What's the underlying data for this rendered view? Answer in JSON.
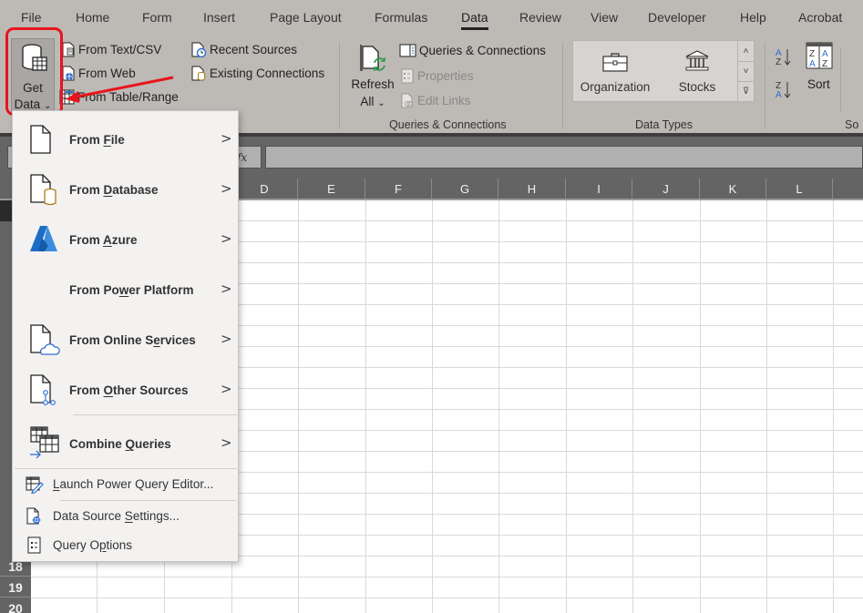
{
  "tabs": [
    {
      "label": "File"
    },
    {
      "label": "Home"
    },
    {
      "label": "Form"
    },
    {
      "label": "Insert"
    },
    {
      "label": "Page Layout"
    },
    {
      "label": "Formulas"
    },
    {
      "label": "Data",
      "active": true
    },
    {
      "label": "Review"
    },
    {
      "label": "View"
    },
    {
      "label": "Developer"
    },
    {
      "label": "Help"
    },
    {
      "label": "Acrobat"
    }
  ],
  "ribbon": {
    "get_data": {
      "line1": "Get",
      "line2": "Data",
      "caret": "⌄"
    },
    "get_transform": {
      "from_text_csv": "From Text/CSV",
      "from_web": "From Web",
      "from_table_range": "From Table/Range",
      "recent_sources": "Recent Sources",
      "existing_connections": "Existing Connections"
    },
    "queries": {
      "refresh_line1": "Refresh",
      "refresh_line2": "All",
      "refresh_caret": "⌄",
      "queries_connections": "Queries & Connections",
      "properties": "Properties",
      "edit_links": "Edit Links",
      "group_label": "Queries & Connections"
    },
    "data_types": {
      "organization": "Organization",
      "stocks": "Stocks",
      "group_label": "Data Types",
      "scroll_up": "˄",
      "scroll_down": "˅",
      "more": "⊽"
    },
    "sort_filter": {
      "sort": "Sort",
      "group_label_partial": "So"
    }
  },
  "formula_bar": {
    "fx": "fx",
    "value": ""
  },
  "columns": [
    "D",
    "E",
    "F",
    "G",
    "H",
    "I",
    "J",
    "K",
    "L"
  ],
  "rows": [
    "18",
    "19",
    "20"
  ],
  "menu": {
    "items": [
      {
        "pre": "From ",
        "ul": "F",
        "post": "ile",
        "chevron": ">"
      },
      {
        "pre": "From ",
        "ul": "D",
        "post": "atabase",
        "chevron": ">"
      },
      {
        "pre": "From ",
        "ul": "A",
        "post": "zure",
        "chevron": ">"
      },
      {
        "pre": "From Po",
        "ul": "w",
        "post": "er Platform",
        "chevron": ">"
      },
      {
        "pre": "From Online S",
        "ul": "e",
        "post": "rvices",
        "chevron": ">"
      },
      {
        "pre": "From ",
        "ul": "O",
        "post": "ther Sources",
        "chevron": ">"
      },
      {
        "pre": "Combine ",
        "ul": "Q",
        "post": "ueries",
        "chevron": ">"
      }
    ],
    "actions": [
      {
        "pre": "",
        "ul": "L",
        "post": "aunch Power Query Editor..."
      },
      {
        "pre": "Data Source ",
        "ul": "S",
        "post": "ettings..."
      },
      {
        "pre": "Query O",
        "ul": "p",
        "post": "tions"
      }
    ]
  },
  "colors": {
    "ribbon_bg": "#bdb9b5",
    "annotation_red": "#e8141c",
    "menu_bg": "#f3f2f1",
    "header_dark": "#646464",
    "azure_blue": "#1e6dc4"
  }
}
